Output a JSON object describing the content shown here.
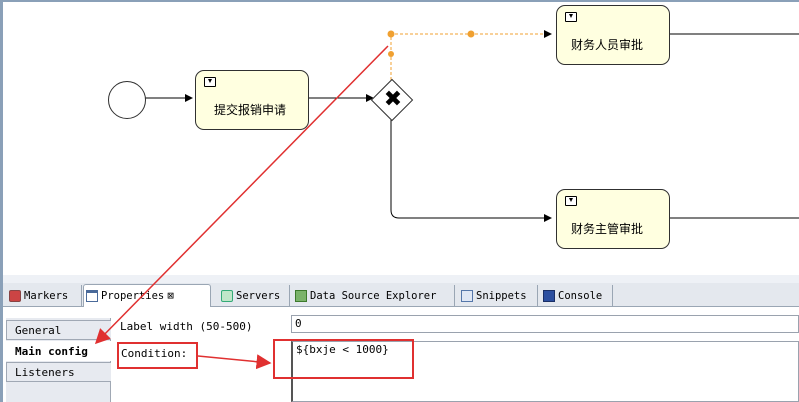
{
  "diagram": {
    "tasks": {
      "submit": "提交报销申请",
      "finance_staff": "财务人员审批",
      "finance_manager": "财务主管审批"
    },
    "gateway_symbol": "✖"
  },
  "tabs": [
    {
      "label": "Markers",
      "icon": "markers-icon"
    },
    {
      "label": "Properties",
      "close": "⊠",
      "icon": "properties-icon"
    },
    {
      "label": "Servers",
      "icon": "servers-icon"
    },
    {
      "label": "Data Source Explorer",
      "icon": "data-source-icon"
    },
    {
      "label": "Snippets",
      "icon": "snippets-icon"
    },
    {
      "label": "Console",
      "icon": "console-icon"
    }
  ],
  "properties": {
    "side_tabs": [
      "General",
      "Main config",
      "Listeners"
    ],
    "label_width_label": "Label width (50-500)",
    "label_width_value": "0",
    "condition_label": "Condition:",
    "condition_value": "${bxje < 1000}"
  },
  "colors": {
    "task_fill": "#ffffe0",
    "annotation": "#e03030",
    "selected_flow": "#f0a030"
  }
}
